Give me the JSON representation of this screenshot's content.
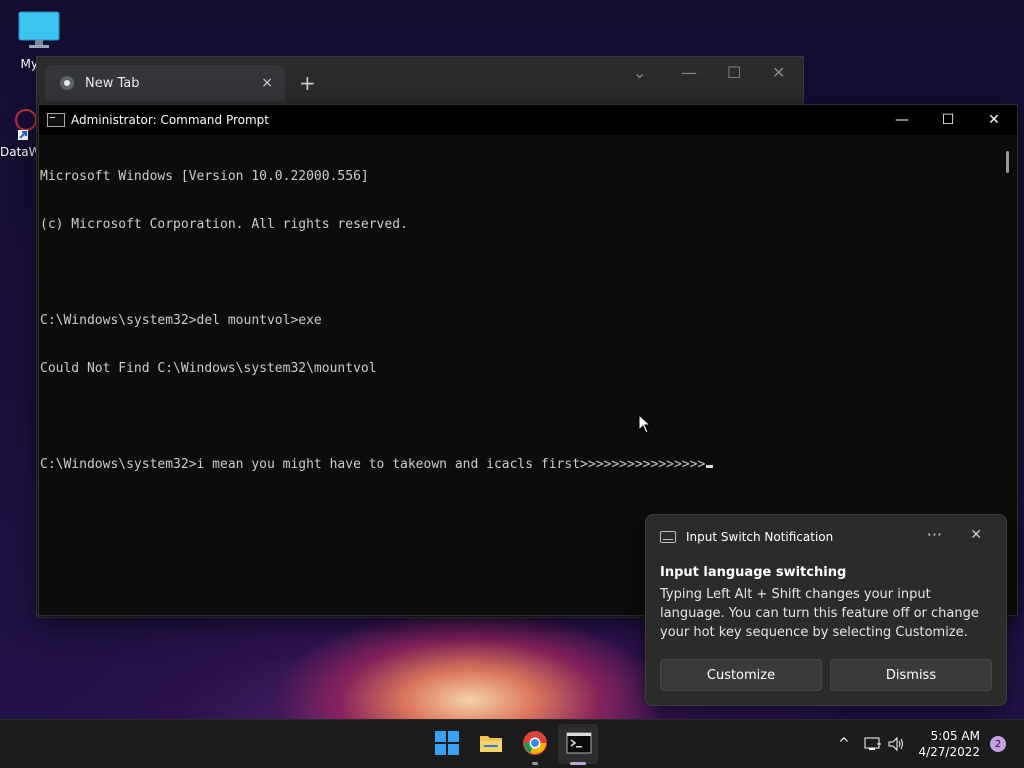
{
  "desktop": {
    "icons": [
      {
        "label": "My Co",
        "icon": "monitor-icon"
      },
      {
        "label": "DataW",
        "icon": "app-shortcut-icon"
      }
    ]
  },
  "browser": {
    "tab_title": "New Tab",
    "tab_icon": "chrome-icon",
    "close_tab": "×",
    "new_tab": "+",
    "tab_search": "⌄",
    "minimize": "—",
    "maximize": "☐",
    "close": "✕"
  },
  "cmd": {
    "title": "Administrator: Command Prompt",
    "minimize": "—",
    "maximize": "☐",
    "close": "✕",
    "lines": [
      "Microsoft Windows [Version 10.0.22000.556]",
      "(c) Microsoft Corporation. All rights reserved.",
      "",
      "C:\\Windows\\system32>del mountvol>exe",
      "Could Not Find C:\\Windows\\system32\\mountvol",
      "",
      "C:\\Windows\\system32>i mean you might have to takeown and icacls first>>>>>>>>>>>>>>>>"
    ]
  },
  "notification": {
    "header": "Input Switch Notification",
    "more": "···",
    "close": "✕",
    "title": "Input language switching",
    "body": "Typing Left Alt + Shift changes your input language. You can turn this feature off or change your hot key sequence by selecting Customize.",
    "customize_label": "Customize",
    "dismiss_label": "Dismiss"
  },
  "taskbar": {
    "apps": [
      "start-icon",
      "file-explorer-icon",
      "chrome-icon",
      "terminal-icon"
    ],
    "tray_chevron": "^",
    "time": "5:05 AM",
    "date": "4/27/2022",
    "notification_count": "2",
    "colors": {
      "start": "#3aa0f0",
      "explorer": "#f2c14e",
      "accent": "#c8a0e0"
    }
  }
}
